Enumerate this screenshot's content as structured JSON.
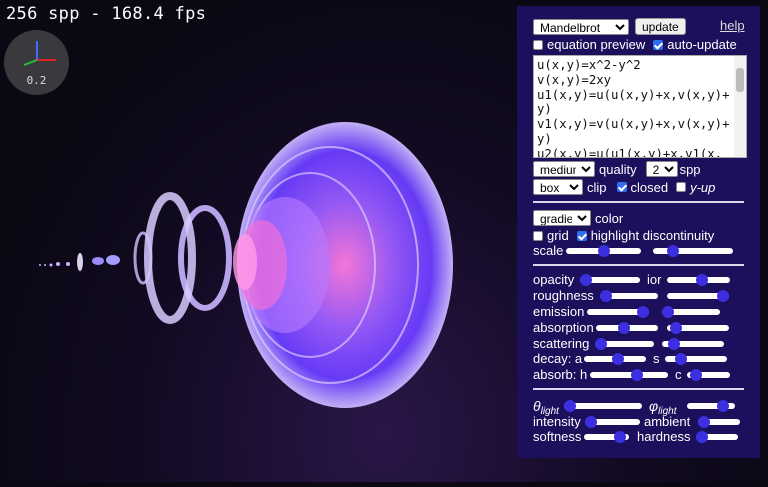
{
  "status": {
    "fps_text": "256 spp - 168.4 fps",
    "gizmo_value": "0.2"
  },
  "colors": {
    "panel_bg": "#1c0f5c",
    "slider_thumb": "#3b2fe0",
    "accent_check": "#2f6cf0"
  },
  "panel": {
    "fractal_select": "Mandelbrot",
    "update_label": "update",
    "help_label": "help",
    "equation_preview": {
      "label": "equation preview",
      "checked": false
    },
    "auto_update": {
      "label": "auto-update",
      "checked": true
    },
    "equations": [
      "u(x,y)=x^2-y^2",
      "v(x,y)=2xy",
      "u1(x,y)=u(u(x,y)+x,v(x,y)+",
      "y)",
      "v1(x,y)=v(u(x,y)+x,v(x,y)+",
      "y)",
      "u2(x,y)=u(u1(x,y)+x,v1(x,"
    ],
    "quality_select": "medium",
    "quality_label": "quality",
    "spp_select": "2⁸",
    "spp_label": "spp",
    "clip_select": "box",
    "clip_label": "clip",
    "closed": {
      "label": "closed",
      "checked": true
    },
    "y_up": {
      "label": "y-up",
      "checked": false
    },
    "color_select": "gradient",
    "color_label": "color",
    "grid": {
      "label": "grid",
      "checked": false
    },
    "highlight": {
      "label": "highlight discontinuity",
      "checked": true
    },
    "scale_label": "scale",
    "scale_values": [
      0.5,
      0.25
    ],
    "opacity_label": "opacity",
    "opacity": 0.08,
    "ior_label": "ior",
    "ior": 0.55,
    "roughness_label": "roughness",
    "roughness": 0.0,
    "roughness2": 0.95,
    "emission_label": "emission",
    "emission": 0.95,
    "emission2": 0.0,
    "absorption_label": "absorption",
    "absorption": 0.45,
    "absorption2": 0.15,
    "scattering_label": "scattering",
    "scattering": 0.0,
    "scattering2": 0.2,
    "decay_label": "decay: a",
    "decay_a": 0.55,
    "decay_s_label": "s",
    "decay_s": 0.25,
    "absorb_label": "absorb: h",
    "absorb_h": 0.6,
    "absorb_c_label": "c",
    "absorb_c": 0.2,
    "theta_label": "θ",
    "theta_sub": "light",
    "theta": 0.0,
    "phi_label": "φ",
    "phi_sub": "light",
    "phi": 0.75,
    "intensity_label": "intensity",
    "intensity": 0.0,
    "ambient_label": "ambient",
    "ambient": 0.0,
    "softness_label": "softness",
    "softness": 0.8,
    "hardness_label": "hardness",
    "hardness": 0.0
  }
}
